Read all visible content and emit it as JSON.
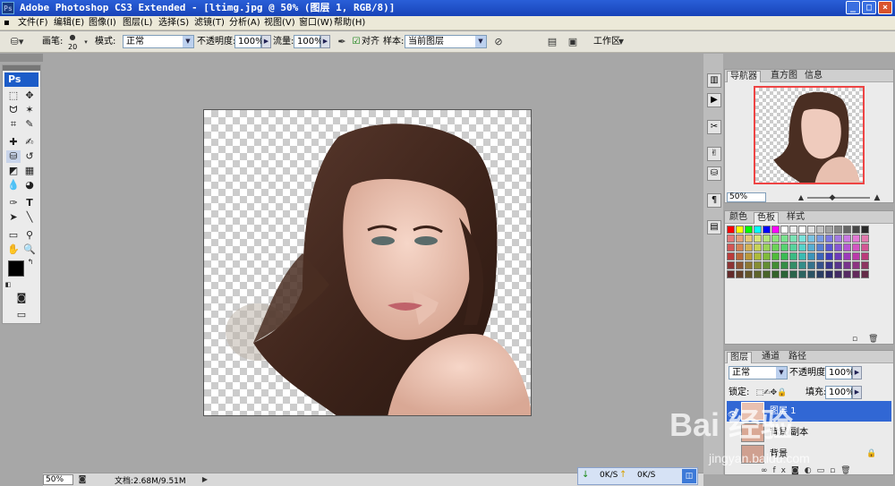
{
  "window": {
    "title": "Adobe Photoshop CS3 Extended - [ltimg.jpg @ 50% (图层 1, RGB/8)]",
    "app_icon": "Ps"
  },
  "menu": [
    "文件(F)",
    "编辑(E)",
    "图像(I)",
    "图层(L)",
    "选择(S)",
    "滤镜(T)",
    "分析(A)",
    "视图(V)",
    "窗口(W)",
    "帮助(H)"
  ],
  "options": {
    "brush_label": "画笔:",
    "brush_size": "20",
    "mode_label": "模式:",
    "mode_value": "正常",
    "opacity_label": "不透明度:",
    "opacity_value": "100%",
    "flow_label": "流量:",
    "flow_value": "100%",
    "aligned_label": "对齐",
    "sample_label": "样本:",
    "sample_value": "当前图层",
    "workspace_label": "工作区"
  },
  "toolbox": {
    "logo": "Ps",
    "tools": [
      "marquee-tool",
      "move-tool",
      "lasso-tool",
      "magic-wand-tool",
      "crop-tool",
      "slice-tool",
      "healing-brush-tool",
      "brush-tool",
      "clone-stamp-tool",
      "history-brush-tool",
      "eraser-tool",
      "gradient-tool",
      "blur-tool",
      "dodge-tool",
      "pen-tool",
      "type-tool",
      "path-selection-tool",
      "line-tool",
      "notes-tool",
      "eyedropper-tool",
      "hand-tool",
      "zoom-tool"
    ]
  },
  "navigator": {
    "tabs": [
      "导航器",
      "直方图",
      "信息"
    ],
    "zoom": "50%"
  },
  "swatches": {
    "tabs": [
      "颜色",
      "色板",
      "样式"
    ]
  },
  "layers": {
    "tabs": [
      "图层",
      "通道",
      "路径"
    ],
    "blend_mode": "正常",
    "opacity_label": "不透明度:",
    "opacity_value": "100%",
    "lock_label": "锁定:",
    "fill_label": "填充:",
    "fill_value": "100%",
    "items": [
      {
        "name": "图层 1"
      },
      {
        "name": "背景 副本"
      },
      {
        "name": "背景"
      }
    ]
  },
  "status": {
    "zoom": "50%",
    "doc_info": "文档:2.68M/9.51M"
  },
  "net": {
    "down": "0K/S",
    "up": "0K/S"
  },
  "watermark": {
    "text1": "Bai 经验",
    "text2": "jingyan.baidu.com"
  },
  "colors": {
    "titlebar": "#1a4bc6",
    "foreground": "#000000",
    "background": "#ffffff",
    "selected_layer": "#3167d4"
  }
}
